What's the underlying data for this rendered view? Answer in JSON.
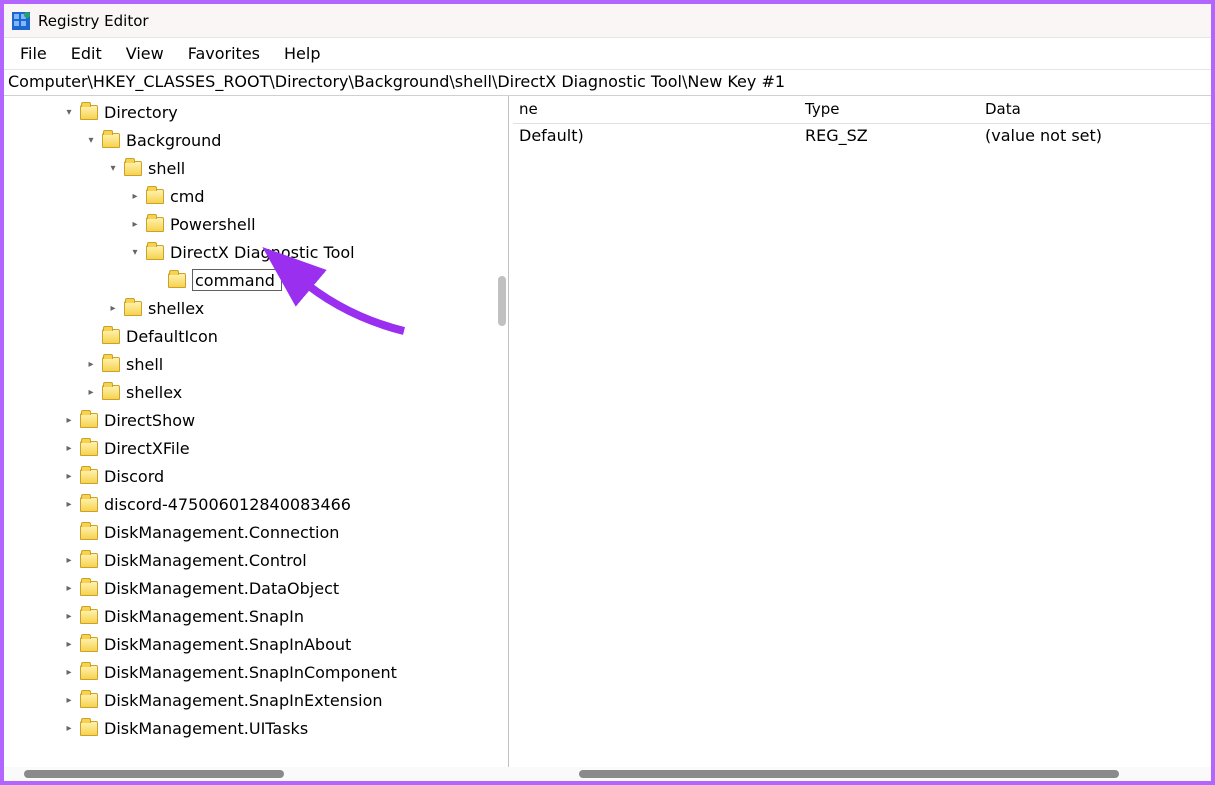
{
  "window": {
    "title": "Registry Editor"
  },
  "menu": {
    "file": "File",
    "edit": "Edit",
    "view": "View",
    "favorites": "Favorites",
    "help": "Help"
  },
  "address": "Computer\\HKEY_CLASSES_ROOT\\Directory\\Background\\shell\\DirectX Diagnostic Tool\\New Key #1",
  "tree": {
    "directory": "Directory",
    "background": "Background",
    "shell_inner": "shell",
    "cmd": "cmd",
    "powershell": "Powershell",
    "dxdiag": "DirectX Diagnostic Tool",
    "command_edit": "command",
    "shellex_inner": "shellex",
    "defaulticon": "DefaultIcon",
    "shell": "shell",
    "shellex": "shellex",
    "directshow": "DirectShow",
    "directxfile": "DirectXFile",
    "discord": "Discord",
    "discord_id": "discord-475006012840083466",
    "dm_connection": "DiskManagement.Connection",
    "dm_control": "DiskManagement.Control",
    "dm_dataobject": "DiskManagement.DataObject",
    "dm_snapin": "DiskManagement.SnapIn",
    "dm_snapin_about": "DiskManagement.SnapInAbout",
    "dm_snapin_component": "DiskManagement.SnapInComponent",
    "dm_snapin_extension": "DiskManagement.SnapInExtension",
    "dm_uitasks": "DiskManagement.UITasks"
  },
  "list": {
    "headers": {
      "name": "ne",
      "type": "Type",
      "data": "Data"
    },
    "rows": [
      {
        "name": "Default)",
        "type": "REG_SZ",
        "data": "(value not set)"
      }
    ]
  }
}
